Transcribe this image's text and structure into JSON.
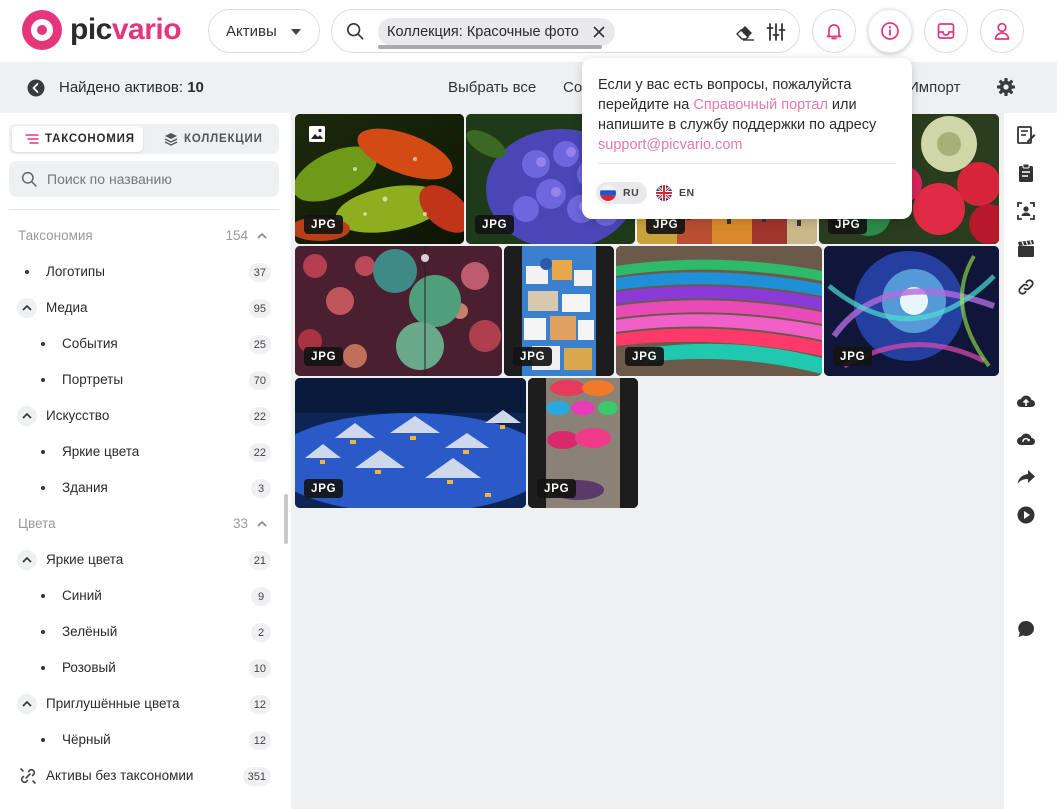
{
  "brand": {
    "logo_part1": "pic",
    "logo_part2": "vario",
    "accent": "#e5357b"
  },
  "header": {
    "scope_select": "Активы",
    "search_chip": "Коллекция: Красочные фото",
    "icons": [
      "search-icon",
      "eraser-icon",
      "filter-icon",
      "bell-icon",
      "info-icon",
      "inbox-icon",
      "user-icon"
    ]
  },
  "subbar": {
    "found_label": "Найдено активов: ",
    "found_count": "10",
    "select_all": "Выбрать все",
    "sort_partial": "Со",
    "import_partial": "Импорт"
  },
  "sidebar": {
    "tabs": [
      {
        "label": "ТАКСОНОМИЯ",
        "active": true
      },
      {
        "label": "КОЛЛЕКЦИИ",
        "active": false
      }
    ],
    "search_placeholder": "Поиск по названию",
    "sections": [
      {
        "title": "Таксономия",
        "count": "154"
      },
      {
        "title": "Цвета",
        "count": "33"
      }
    ],
    "taxonomy": [
      {
        "label": "Логотипы",
        "count": "37"
      },
      {
        "label": "Медиа",
        "count": "95"
      },
      {
        "label": "События",
        "count": "25"
      },
      {
        "label": "Портреты",
        "count": "70"
      },
      {
        "label": "Искусство",
        "count": "22"
      },
      {
        "label": "Яркие цвета",
        "count": "22"
      },
      {
        "label": "Здания",
        "count": "3"
      }
    ],
    "colors": [
      {
        "label": "Яркие цвета",
        "count": "21"
      },
      {
        "label": "Синий",
        "count": "9"
      },
      {
        "label": "Зелёный",
        "count": "2"
      },
      {
        "label": "Розовый",
        "count": "10"
      },
      {
        "label": "Приглушённые цвета",
        "count": "12"
      },
      {
        "label": "Чёрный",
        "count": "12"
      }
    ],
    "untaxed": {
      "label": "Активы без таксономии",
      "count": "351"
    }
  },
  "assets": [
    {
      "type": "JPG",
      "subject": "wet red-green leaves"
    },
    {
      "type": "JPG",
      "subject": "blue hydrangea"
    },
    {
      "type": "JPG",
      "subject": "colorful town"
    },
    {
      "type": "JPG",
      "subject": "paper roses"
    },
    {
      "type": "JPG",
      "subject": "lantern bokeh"
    },
    {
      "type": "JPG",
      "subject": "santorini houses"
    },
    {
      "type": "JPG",
      "subject": "colorful kayaks"
    },
    {
      "type": "JPG",
      "subject": "blue abstract swirl"
    },
    {
      "type": "JPG",
      "subject": "snowy village night"
    },
    {
      "type": "JPG",
      "subject": "colorful yarn"
    }
  ],
  "popover": {
    "text_before_link": "Если у вас есть вопросы, пожалуйста перейдите на ",
    "portal_link": "Справочный портал",
    "text_middle": " или напишите в службу поддержки по адресу ",
    "email_link": "support@picvario.com",
    "languages": [
      {
        "code": "RU",
        "active": true
      },
      {
        "code": "EN",
        "active": false
      }
    ]
  }
}
